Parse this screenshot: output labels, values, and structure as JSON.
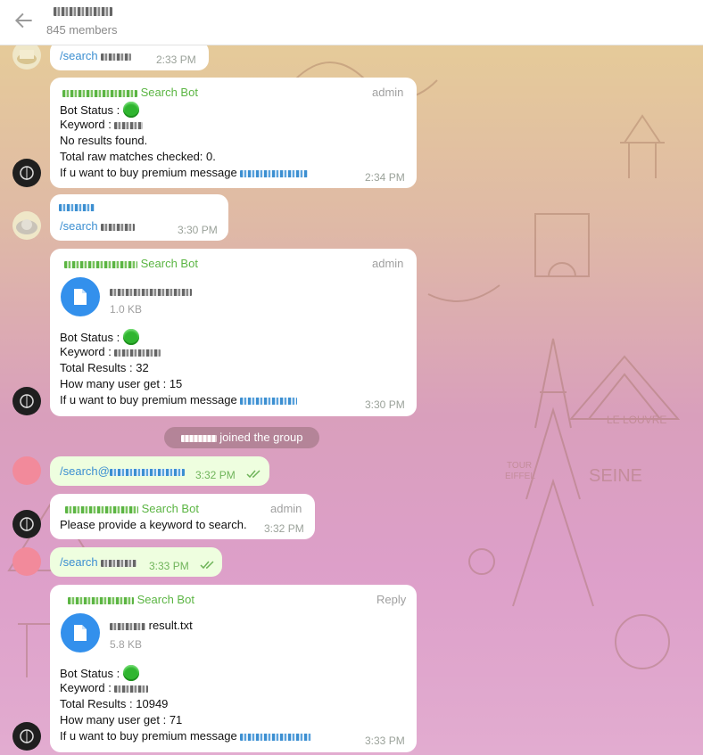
{
  "header": {
    "title": "▆▆▆ ▆▆",
    "members": "845 members"
  },
  "messages": {
    "m1": {
      "text": "/search",
      "time": "2:33 PM"
    },
    "m2": {
      "sender": "Search Bot",
      "role": "admin",
      "status": "Bot Status :",
      "keyword": "Keyword :",
      "noresults": "No results found.",
      "total": "Total raw matches checked: 0.",
      "premium": "If u want to buy premium message",
      "time": "2:34 PM"
    },
    "m3": {
      "text": "/search",
      "time": "3:30 PM"
    },
    "m4": {
      "sender": "Search Bot",
      "role": "admin",
      "file_size": "1.0 KB",
      "status": "Bot Status :",
      "keyword": "Keyword :",
      "total": "Total Results : 32",
      "users": "How many user get : 15",
      "premium": "If u want to buy premium message",
      "time": "3:30 PM"
    },
    "service": {
      "text": "joined the group"
    },
    "m5": {
      "text": "/search@",
      "time": "3:32 PM"
    },
    "m6": {
      "sender": "Search Bot",
      "role": "admin",
      "text": "Please provide a keyword to search.",
      "time": "3:32 PM"
    },
    "m7": {
      "text": "/search",
      "time": "3:33 PM"
    },
    "m8": {
      "sender": "Search Bot",
      "role": "Reply",
      "file_name": "result.txt",
      "file_size": "5.8 KB",
      "status": "Bot Status :",
      "keyword": "Keyword :",
      "total": "Total Results : 10949",
      "users": "How many user get : 71",
      "premium": "If u want to buy premium message",
      "time": "3:33 PM"
    }
  },
  "colors": {
    "accent": "#3390ec",
    "sender": "#5bb543",
    "status_dot": "#2fb52f"
  },
  "icons": [
    "back-arrow-icon",
    "file-icon",
    "double-check-icon"
  ]
}
